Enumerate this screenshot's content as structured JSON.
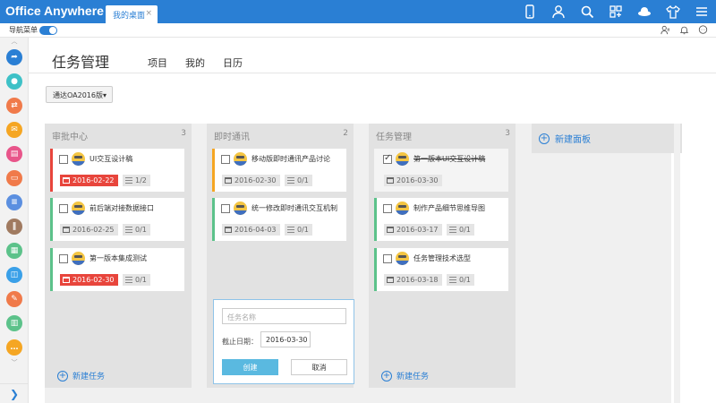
{
  "app": {
    "logo": "Office Anywhere",
    "tab_label": "我的桌面",
    "tab_close": "×"
  },
  "subbar": {
    "nav_label": "导航菜单",
    "nav_toggle_on": true
  },
  "header": {
    "title": "任务管理",
    "links": [
      "项目",
      "我的",
      "日历"
    ]
  },
  "selector": {
    "label": "通达OA2016版▾"
  },
  "columns": [
    {
      "title": "审批中心",
      "count": "3",
      "add_label": "新建任务",
      "cards": [
        {
          "text": "UI交互设计稿",
          "date": "2016-02-22",
          "overdue": true,
          "progress": "1/2",
          "checked": false,
          "stripe": "red"
        },
        {
          "text": "前后端对接数据接口",
          "date": "2016-02-25",
          "overdue": false,
          "progress": "0/1",
          "checked": false,
          "stripe": "green"
        },
        {
          "text": "第一版本集成测试",
          "date": "2016-02-30",
          "overdue": true,
          "progress": "0/1",
          "checked": false,
          "stripe": "green"
        }
      ]
    },
    {
      "title": "即时通讯",
      "count": "2",
      "cards": [
        {
          "text": "移动版即时通讯产品讨论",
          "date": "2016-02-30",
          "overdue": false,
          "progress": "0/1",
          "checked": false,
          "stripe": "orange"
        },
        {
          "text": "统一修改即时通讯交互机制",
          "date": "2016-04-03",
          "overdue": false,
          "progress": "0/1",
          "checked": false,
          "stripe": "green"
        }
      ]
    },
    {
      "title": "任务管理",
      "count": "3",
      "add_label": "新建任务",
      "cards": [
        {
          "text": "第一版本UI交互设计稿",
          "date": "2016-03-30",
          "overdue": false,
          "progress": "",
          "checked": true,
          "stripe": "none"
        },
        {
          "text": "制作产品细节思维导图",
          "date": "2016-03-17",
          "overdue": false,
          "progress": "0/1",
          "checked": false,
          "stripe": "green"
        },
        {
          "text": "任务管理技术选型",
          "date": "2016-03-18",
          "overdue": false,
          "progress": "0/1",
          "checked": false,
          "stripe": "green"
        }
      ]
    }
  ],
  "new_panel": {
    "label": "新建面板"
  },
  "new_task_form": {
    "name_placeholder": "任务名称",
    "deadline_label": "截止日期：",
    "deadline_value": "2016-03-30",
    "create_label": "创建",
    "cancel_label": "取消"
  },
  "colors": {
    "brand": "#2a7fd4",
    "red": "#e8453c",
    "green": "#5cc28a",
    "orange": "#f5a623"
  },
  "top_icons": [
    "phone-icon",
    "user-icon",
    "search-icon",
    "apps-icon",
    "skin-icon",
    "shirt-icon",
    "menu-icon"
  ],
  "sub_icons": [
    "contacts-icon",
    "bell-icon",
    "chat-icon"
  ],
  "sidebar_icons": [
    "share-icon",
    "person-icon",
    "flow-icon",
    "mail-icon",
    "book-icon",
    "doc-icon",
    "note-icon",
    "hr-icon",
    "calendar-icon",
    "message-icon",
    "sign-icon",
    "chart-icon",
    "chat-icon"
  ]
}
